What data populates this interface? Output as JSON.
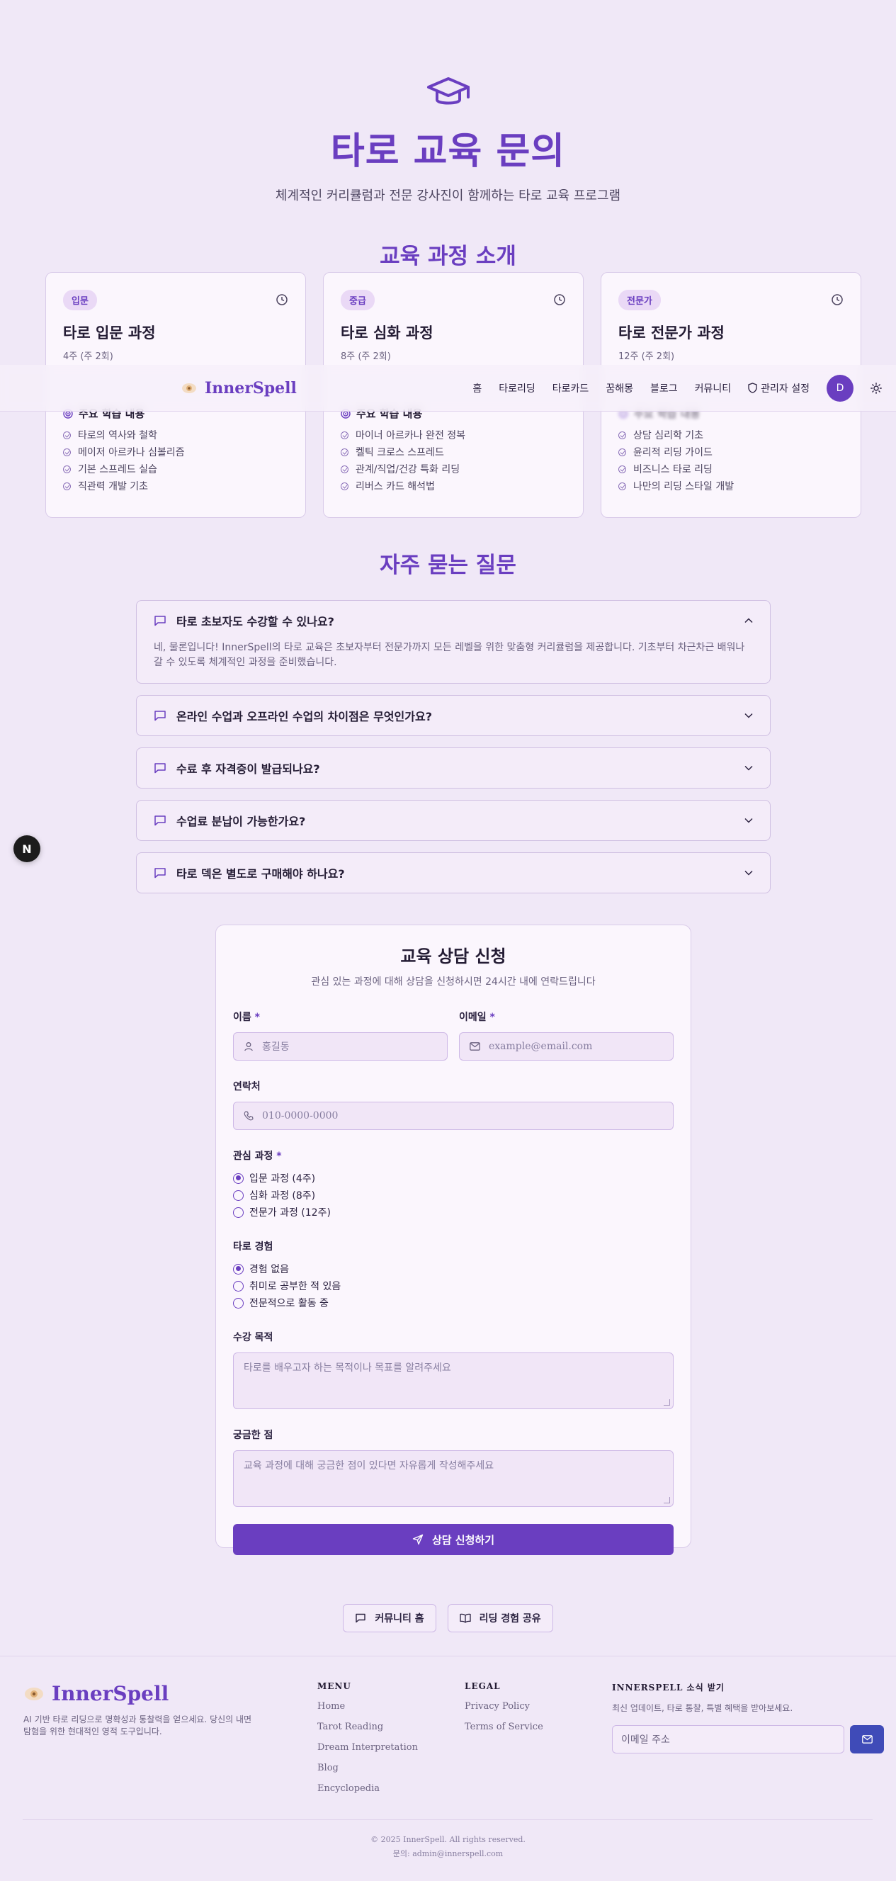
{
  "hero": {
    "title": "타로 교육 문의",
    "subtitle": "체계적인 커리큘럼과 전문 강사진이 함께하는 타로 교육 프로그램"
  },
  "courses_section": {
    "title": "교육 과정 소개",
    "learn_heading": "주요 학습 내용",
    "cards": [
      {
        "badge": "입문",
        "title": "타로 입문 과정",
        "duration": "4주 (주 2회)",
        "items": [
          "타로의 역사와 철학",
          "메이저 아르카나 심볼리즘",
          "기본 스프레드 실습",
          "직관력 개발 기초"
        ]
      },
      {
        "badge": "중급",
        "title": "타로 심화 과정",
        "duration": "8주 (주 2회)",
        "items": [
          "마이너 아르카나 완전 정복",
          "켈틱 크로스 스프레드",
          "관계/직업/건강 특화 리딩",
          "리버스 카드 해석법"
        ]
      },
      {
        "badge": "전문가",
        "title": "타로 전문가 과정",
        "duration": "12주 (주 2회)",
        "items": [
          "상담 심리학 기초",
          "윤리적 리딩 가이드",
          "비즈니스 타로 리딩",
          "나만의 리딩 스타일 개발"
        ]
      }
    ]
  },
  "navbar": {
    "brand": "InnerSpell",
    "links": [
      "홈",
      "타로리딩",
      "타로카드",
      "꿈해몽",
      "블로그",
      "커뮤니티"
    ],
    "admin": "관리자 설정",
    "avatar_initial": "D"
  },
  "faq": {
    "title": "자주 묻는 질문",
    "items": [
      {
        "q": "타로 초보자도 수강할 수 있나요?",
        "a": "네, 물론입니다! InnerSpell의 타로 교육은 초보자부터 전문가까지 모든 레벨을 위한 맞춤형 커리큘럼을 제공합니다. 기초부터 차근차근 배워나갈 수 있도록 체계적인 과정을 준비했습니다."
      },
      {
        "q": "온라인 수업과 오프라인 수업의 차이점은 무엇인가요?"
      },
      {
        "q": "수료 후 자격증이 발급되나요?"
      },
      {
        "q": "수업료 분납이 가능한가요?"
      },
      {
        "q": "타로 덱은 별도로 구매해야 하나요?"
      }
    ]
  },
  "next_badge": "N",
  "form": {
    "title": "교육 상담 신청",
    "subtitle": "관심 있는 과정에 대해 상담을 신청하시면 24시간 내에 연락드립니다",
    "name_label": "이름",
    "name_placeholder": "홍길동",
    "email_label": "이메일",
    "email_placeholder": "example@email.com",
    "phone_label": "연락처",
    "phone_placeholder": "010-0000-0000",
    "course_label": "관심 과정",
    "course_options": [
      "입문 과정 (4주)",
      "심화 과정 (8주)",
      "전문가 과정 (12주)"
    ],
    "exp_label": "타로 경험",
    "exp_options": [
      "경험 없음",
      "취미로 공부한 적 있음",
      "전문적으로 활동 중"
    ],
    "purpose_label": "수강 목적",
    "purpose_placeholder": "타로를 배우고자 하는 목적이나 목표를 알려주세요",
    "question_label": "궁금한 점",
    "question_placeholder": "교육 과정에 대해 궁금한 점이 있다면 자유롭게 작성해주세요",
    "submit": "상담 신청하기",
    "required_mark": "*"
  },
  "bottom_buttons": {
    "community": "커뮤니티 홈",
    "share": "리딩 경험 공유"
  },
  "footer": {
    "brand": "InnerSpell",
    "tagline": "AI 기반 타로 리딩으로 명확성과 통찰력을 얻으세요. 당신의 내면 탐험을 위한 현대적인 영적 도구입니다.",
    "menu_title": "MENU",
    "menu": [
      "Home",
      "Tarot Reading",
      "Dream Interpretation",
      "Blog",
      "Encyclopedia"
    ],
    "legal_title": "LEGAL",
    "legal": [
      "Privacy Policy",
      "Terms of Service"
    ],
    "news_title": "INNERSPELL 소식 받기",
    "news_desc": "최신 업데이트, 타로 통찰, 특별 혜택을 받아보세요.",
    "news_placeholder": "이메일 주소",
    "copyright": "© 2025 InnerSpell. All rights reserved.",
    "contact": "문의: admin@innerspell.com"
  }
}
